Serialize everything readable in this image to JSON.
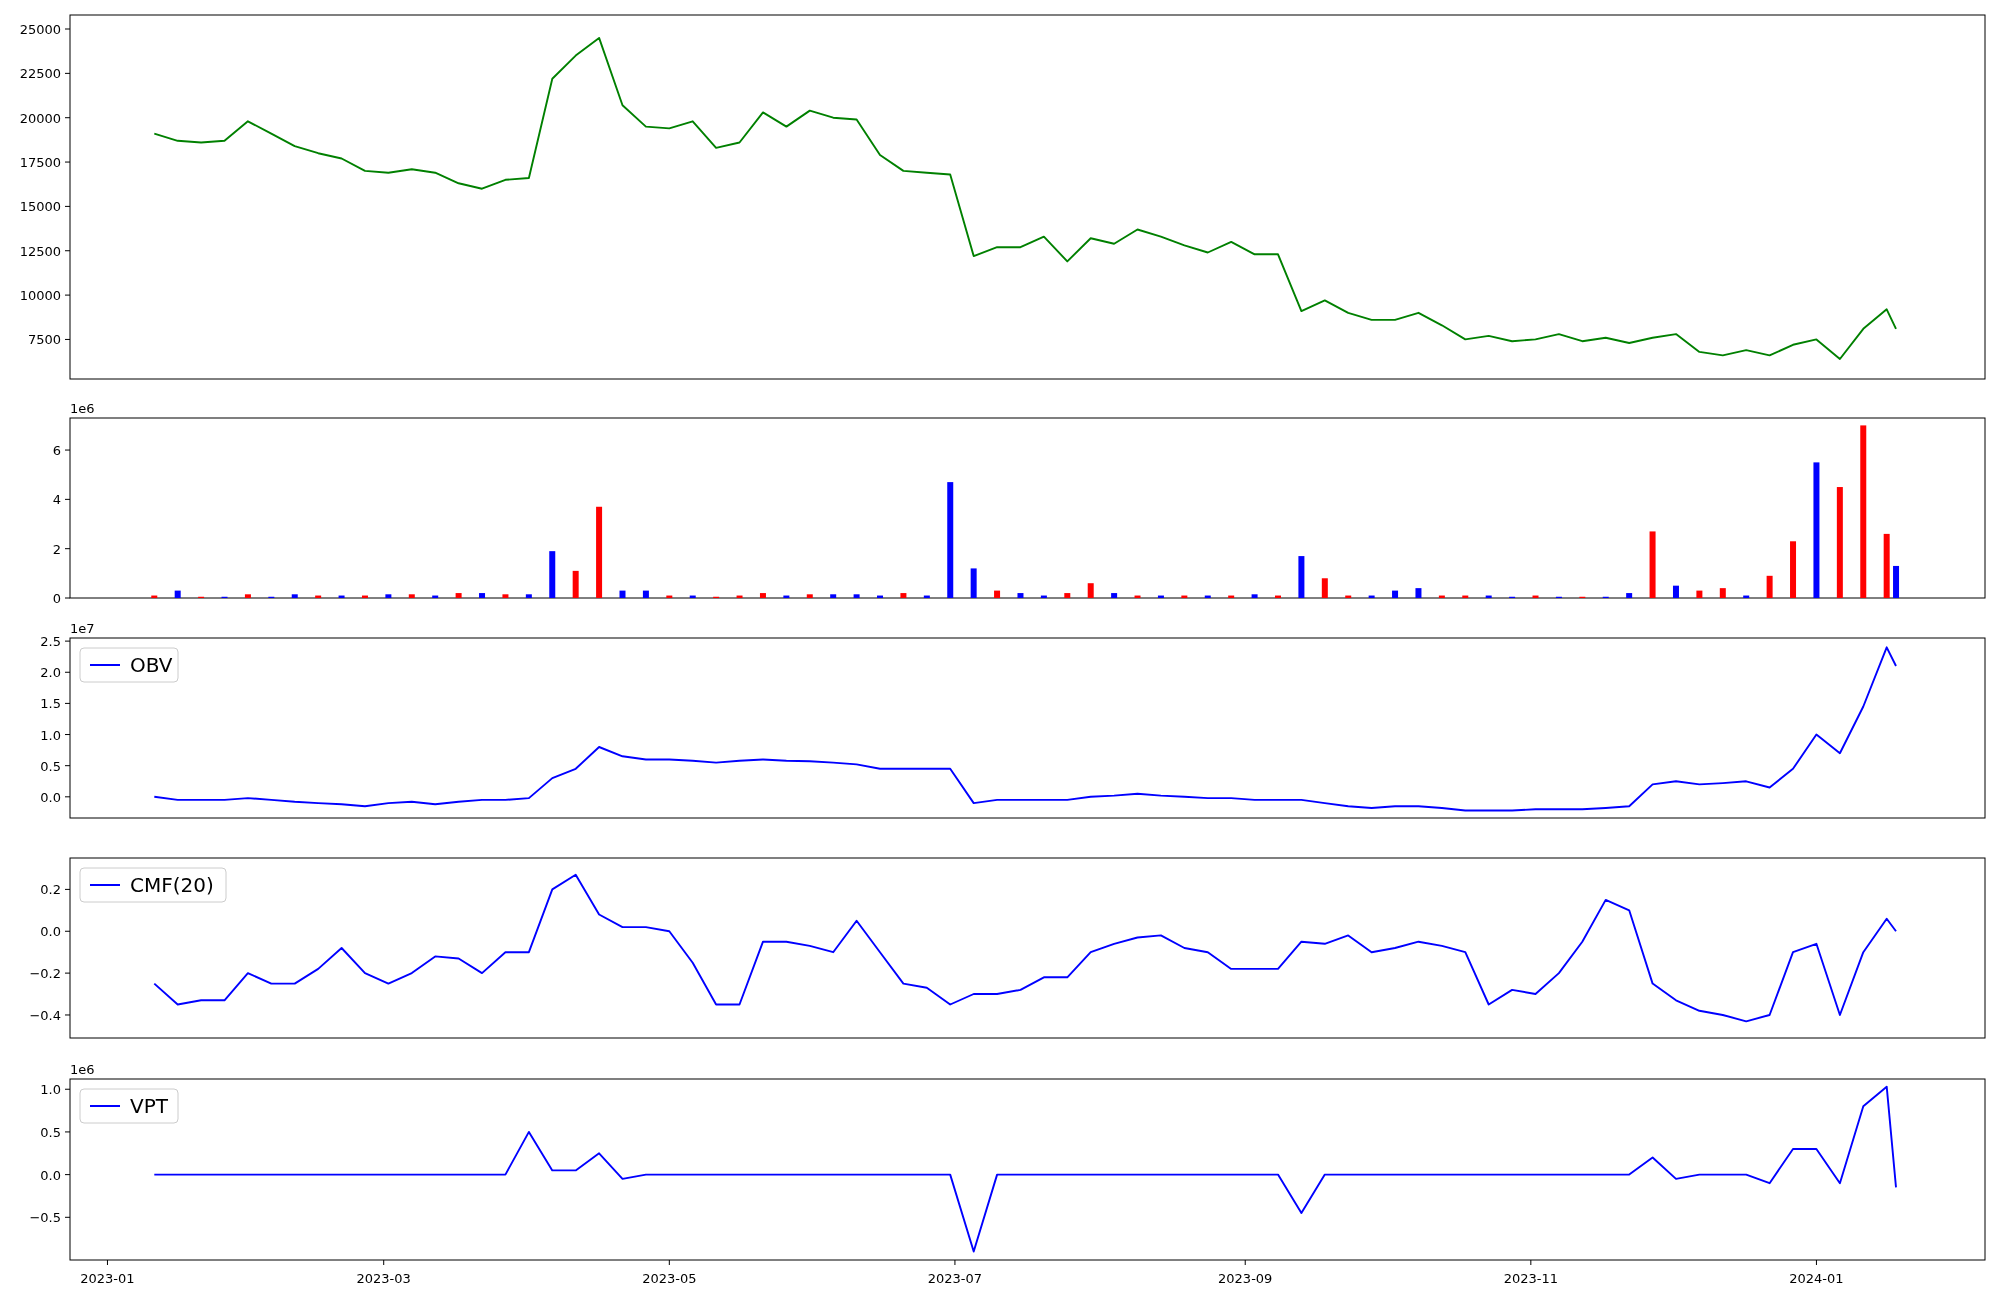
{
  "figure": {
    "panels": [
      {
        "chart_data": {
          "type": "line",
          "xlim": [
            "2022-12-24",
            "2024-02-06"
          ],
          "ylim": [
            5270,
            25790
          ],
          "yticks": [
            7500,
            10000,
            12500,
            15000,
            17500,
            20000,
            22500,
            25000
          ],
          "x": [
            "2023-01-11",
            "2023-01-16",
            "2023-01-21",
            "2023-01-26",
            "2023-01-31",
            "2023-02-05",
            "2023-02-10",
            "2023-02-15",
            "2023-02-20",
            "2023-02-25",
            "2023-03-02",
            "2023-03-07",
            "2023-03-12",
            "2023-03-17",
            "2023-03-22",
            "2023-03-27",
            "2023-04-01",
            "2023-04-06",
            "2023-04-11",
            "2023-04-16",
            "2023-04-21",
            "2023-04-26",
            "2023-05-01",
            "2023-05-06",
            "2023-05-11",
            "2023-05-16",
            "2023-05-21",
            "2023-05-26",
            "2023-05-31",
            "2023-06-05",
            "2023-06-10",
            "2023-06-15",
            "2023-06-20",
            "2023-06-25",
            "2023-06-30",
            "2023-07-05",
            "2023-07-10",
            "2023-07-15",
            "2023-07-20",
            "2023-07-25",
            "2023-07-30",
            "2023-08-04",
            "2023-08-09",
            "2023-08-14",
            "2023-08-19",
            "2023-08-24",
            "2023-08-29",
            "2023-09-03",
            "2023-09-08",
            "2023-09-13",
            "2023-09-18",
            "2023-09-23",
            "2023-09-28",
            "2023-10-03",
            "2023-10-08",
            "2023-10-13",
            "2023-10-18",
            "2023-10-23",
            "2023-10-28",
            "2023-11-02",
            "2023-11-07",
            "2023-11-12",
            "2023-11-17",
            "2023-11-22",
            "2023-11-27",
            "2023-12-02",
            "2023-12-07",
            "2023-12-12",
            "2023-12-17",
            "2023-12-22",
            "2023-12-27",
            "2024-01-01",
            "2024-01-06",
            "2024-01-11",
            "2024-01-16",
            "2024-01-18"
          ],
          "series": [
            {
              "color": "#008000",
              "values": [
                19100,
                18700,
                18600,
                18700,
                19800,
                19100,
                18400,
                18000,
                17700,
                17000,
                16900,
                17100,
                16900,
                16300,
                16000,
                16500,
                16600,
                22200,
                23500,
                24500,
                20700,
                19500,
                19400,
                19800,
                18300,
                18600,
                20300,
                19500,
                20400,
                20000,
                19900,
                17900,
                17000,
                16900,
                16800,
                12200,
                12700,
                12700,
                13300,
                11900,
                13200,
                12900,
                13700,
                13300,
                12800,
                12400,
                13000,
                12300,
                12300,
                9100,
                9700,
                9000,
                8600,
                8600,
                9000,
                8300,
                7500,
                7700,
                7400,
                7500,
                7800,
                7400,
                7600,
                7300,
                7600,
                7800,
                6800,
                6600,
                6900,
                6600,
                7200,
                7500,
                6400,
                8100,
                9200,
                8100
              ]
            }
          ]
        }
      },
      {
        "offset_text": "1e6",
        "chart_data": {
          "type": "bar",
          "xlim": [
            "2022-12-24",
            "2024-02-06"
          ],
          "ylim": [
            0,
            7.3
          ],
          "yticks": [
            0,
            2,
            4,
            6
          ],
          "x": [
            "2023-01-11",
            "2023-01-16",
            "2023-01-21",
            "2023-01-26",
            "2023-01-31",
            "2023-02-05",
            "2023-02-10",
            "2023-02-15",
            "2023-02-20",
            "2023-02-25",
            "2023-03-02",
            "2023-03-07",
            "2023-03-12",
            "2023-03-17",
            "2023-03-22",
            "2023-03-27",
            "2023-04-01",
            "2023-04-06",
            "2023-04-11",
            "2023-04-16",
            "2023-04-21",
            "2023-04-26",
            "2023-05-01",
            "2023-05-06",
            "2023-05-11",
            "2023-05-16",
            "2023-05-21",
            "2023-05-26",
            "2023-05-31",
            "2023-06-05",
            "2023-06-10",
            "2023-06-15",
            "2023-06-20",
            "2023-06-25",
            "2023-06-30",
            "2023-07-05",
            "2023-07-10",
            "2023-07-15",
            "2023-07-20",
            "2023-07-25",
            "2023-07-30",
            "2023-08-04",
            "2023-08-09",
            "2023-08-14",
            "2023-08-19",
            "2023-08-24",
            "2023-08-29",
            "2023-09-03",
            "2023-09-08",
            "2023-09-13",
            "2023-09-18",
            "2023-09-23",
            "2023-09-28",
            "2023-10-03",
            "2023-10-08",
            "2023-10-13",
            "2023-10-18",
            "2023-10-23",
            "2023-10-28",
            "2023-11-02",
            "2023-11-07",
            "2023-11-12",
            "2023-11-17",
            "2023-11-22",
            "2023-11-27",
            "2023-12-02",
            "2023-12-07",
            "2023-12-12",
            "2023-12-17",
            "2023-12-22",
            "2023-12-27",
            "2024-01-01",
            "2024-01-06",
            "2024-01-11",
            "2024-01-16",
            "2024-01-18"
          ],
          "series": [
            {
              "color": "#0000ff",
              "values": [
                null,
                0.3,
                null,
                0.05,
                null,
                0.05,
                0.15,
                null,
                0.1,
                null,
                0.15,
                null,
                0.1,
                null,
                0.2,
                null,
                0.15,
                1.9,
                null,
                null,
                0.3,
                0.3,
                null,
                0.1,
                null,
                null,
                null,
                0.1,
                null,
                0.15,
                0.15,
                0.1,
                null,
                0.1,
                4.7,
                1.2,
                null,
                0.2,
                0.1,
                null,
                null,
                0.2,
                null,
                0.1,
                null,
                0.1,
                null,
                0.15,
                null,
                1.7,
                null,
                null,
                0.1,
                0.3,
                0.4,
                null,
                null,
                0.1,
                0.05,
                null,
                0.05,
                null,
                0.05,
                0.2,
                null,
                0.5,
                null,
                null,
                0.1,
                null,
                null,
                5.5,
                null,
                null,
                null,
                1.3
              ]
            },
            {
              "color": "#ff0000",
              "values": [
                0.1,
                null,
                0.05,
                null,
                0.15,
                null,
                null,
                0.1,
                null,
                0.1,
                null,
                0.15,
                null,
                0.2,
                null,
                0.15,
                null,
                null,
                1.1,
                3.7,
                null,
                null,
                0.1,
                null,
                0.05,
                0.1,
                0.2,
                null,
                0.15,
                null,
                null,
                null,
                0.2,
                null,
                null,
                null,
                0.3,
                null,
                null,
                0.2,
                0.6,
                null,
                0.1,
                null,
                0.1,
                null,
                0.1,
                null,
                0.1,
                null,
                0.8,
                0.1,
                null,
                null,
                null,
                0.1,
                0.1,
                null,
                null,
                0.1,
                null,
                0.05,
                null,
                null,
                2.7,
                null,
                0.3,
                0.4,
                null,
                0.9,
                2.3,
                null,
                4.5,
                7.0,
                2.6,
                null
              ]
            }
          ]
        }
      },
      {
        "offset_text": "1e7",
        "chart_data": {
          "type": "line",
          "xlim": [
            "2022-12-24",
            "2024-02-06"
          ],
          "ylim": [
            -0.34,
            2.55
          ],
          "yticks": [
            {
              "value": 0,
              "label": "0.0"
            },
            {
              "value": 0.5,
              "label": "0.5"
            },
            {
              "value": 1,
              "label": "1.0"
            },
            {
              "value": 1.5,
              "label": "1.5"
            },
            {
              "value": 2,
              "label": "2.0"
            },
            {
              "value": 2.5,
              "label": "2.5"
            }
          ],
          "x": [
            "2023-01-11",
            "2023-01-16",
            "2023-01-21",
            "2023-01-26",
            "2023-01-31",
            "2023-02-05",
            "2023-02-10",
            "2023-02-15",
            "2023-02-20",
            "2023-02-25",
            "2023-03-02",
            "2023-03-07",
            "2023-03-12",
            "2023-03-17",
            "2023-03-22",
            "2023-03-27",
            "2023-04-01",
            "2023-04-06",
            "2023-04-11",
            "2023-04-16",
            "2023-04-21",
            "2023-04-26",
            "2023-05-01",
            "2023-05-06",
            "2023-05-11",
            "2023-05-16",
            "2023-05-21",
            "2023-05-26",
            "2023-05-31",
            "2023-06-05",
            "2023-06-10",
            "2023-06-15",
            "2023-06-20",
            "2023-06-25",
            "2023-06-30",
            "2023-07-05",
            "2023-07-10",
            "2023-07-15",
            "2023-07-20",
            "2023-07-25",
            "2023-07-30",
            "2023-08-04",
            "2023-08-09",
            "2023-08-14",
            "2023-08-19",
            "2023-08-24",
            "2023-08-29",
            "2023-09-03",
            "2023-09-08",
            "2023-09-13",
            "2023-09-18",
            "2023-09-23",
            "2023-09-28",
            "2023-10-03",
            "2023-10-08",
            "2023-10-13",
            "2023-10-18",
            "2023-10-23",
            "2023-10-28",
            "2023-11-02",
            "2023-11-07",
            "2023-11-12",
            "2023-11-17",
            "2023-11-22",
            "2023-11-27",
            "2023-12-02",
            "2023-12-07",
            "2023-12-12",
            "2023-12-17",
            "2023-12-22",
            "2023-12-27",
            "2024-01-01",
            "2024-01-06",
            "2024-01-11",
            "2024-01-16",
            "2024-01-18"
          ],
          "series": [
            {
              "name": "OBV",
              "color": "#0000ff",
              "values": [
                0,
                -0.05,
                -0.05,
                -0.05,
                -0.02,
                -0.05,
                -0.08,
                -0.1,
                -0.12,
                -0.15,
                -0.1,
                -0.08,
                -0.12,
                -0.08,
                -0.05,
                -0.05,
                -0.02,
                0.3,
                0.45,
                0.8,
                0.65,
                0.6,
                0.6,
                0.58,
                0.55,
                0.58,
                0.6,
                0.58,
                0.57,
                0.55,
                0.52,
                0.45,
                0.45,
                0.45,
                0.45,
                -0.1,
                -0.05,
                -0.05,
                -0.05,
                -0.05,
                0,
                0.02,
                0.05,
                0.02,
                0,
                -0.02,
                -0.02,
                -0.05,
                -0.05,
                -0.05,
                -0.1,
                -0.15,
                -0.18,
                -0.15,
                -0.15,
                -0.18,
                -0.22,
                -0.22,
                -0.22,
                -0.2,
                -0.2,
                -0.2,
                -0.18,
                -0.15,
                0.2,
                0.25,
                0.2,
                0.22,
                0.25,
                0.15,
                0.45,
                1.0,
                0.7,
                1.45,
                2.4,
                2.1
              ]
            }
          ]
        }
      },
      {
        "chart_data": {
          "type": "line",
          "xlim": [
            "2022-12-24",
            "2024-02-06"
          ],
          "ylim": [
            -0.51,
            0.35
          ],
          "yticks": [
            {
              "value": -0.4,
              "label": "−0.4"
            },
            {
              "value": -0.2,
              "label": "−0.2"
            },
            {
              "value": 0,
              "label": "0.0"
            },
            {
              "value": 0.2,
              "label": "0.2"
            }
          ],
          "x": [
            "2023-01-11",
            "2023-01-16",
            "2023-01-21",
            "2023-01-26",
            "2023-01-31",
            "2023-02-05",
            "2023-02-10",
            "2023-02-15",
            "2023-02-20",
            "2023-02-25",
            "2023-03-02",
            "2023-03-07",
            "2023-03-12",
            "2023-03-17",
            "2023-03-22",
            "2023-03-27",
            "2023-04-01",
            "2023-04-06",
            "2023-04-11",
            "2023-04-16",
            "2023-04-21",
            "2023-04-26",
            "2023-05-01",
            "2023-05-06",
            "2023-05-11",
            "2023-05-16",
            "2023-05-21",
            "2023-05-26",
            "2023-05-31",
            "2023-06-05",
            "2023-06-10",
            "2023-06-15",
            "2023-06-20",
            "2023-06-25",
            "2023-06-30",
            "2023-07-05",
            "2023-07-10",
            "2023-07-15",
            "2023-07-20",
            "2023-07-25",
            "2023-07-30",
            "2023-08-04",
            "2023-08-09",
            "2023-08-14",
            "2023-08-19",
            "2023-08-24",
            "2023-08-29",
            "2023-09-03",
            "2023-09-08",
            "2023-09-13",
            "2023-09-18",
            "2023-09-23",
            "2023-09-28",
            "2023-10-03",
            "2023-10-08",
            "2023-10-13",
            "2023-10-18",
            "2023-10-23",
            "2023-10-28",
            "2023-11-02",
            "2023-11-07",
            "2023-11-12",
            "2023-11-17",
            "2023-11-22",
            "2023-11-27",
            "2023-12-02",
            "2023-12-07",
            "2023-12-12",
            "2023-12-17",
            "2023-12-22",
            "2023-12-27",
            "2024-01-01",
            "2024-01-06",
            "2024-01-11",
            "2024-01-16",
            "2024-01-18"
          ],
          "series": [
            {
              "name": "CMF(20)",
              "color": "#0000ff",
              "values": [
                -0.25,
                -0.35,
                -0.33,
                -0.33,
                -0.2,
                -0.25,
                -0.25,
                -0.18,
                -0.08,
                -0.2,
                -0.25,
                -0.2,
                -0.12,
                -0.13,
                -0.2,
                -0.1,
                -0.1,
                0.2,
                0.27,
                0.08,
                0.02,
                0.02,
                0,
                -0.15,
                -0.35,
                -0.35,
                -0.05,
                -0.05,
                -0.07,
                -0.1,
                0.05,
                -0.1,
                -0.25,
                -0.27,
                -0.35,
                -0.3,
                -0.3,
                -0.28,
                -0.22,
                -0.22,
                -0.1,
                -0.06,
                -0.03,
                -0.02,
                -0.08,
                -0.1,
                -0.18,
                -0.18,
                -0.18,
                -0.05,
                -0.06,
                -0.02,
                -0.1,
                -0.08,
                -0.05,
                -0.07,
                -0.1,
                -0.35,
                -0.28,
                -0.3,
                -0.2,
                -0.05,
                0.15,
                0.1,
                -0.25,
                -0.33,
                -0.38,
                -0.4,
                -0.43,
                -0.4,
                -0.1,
                -0.06,
                -0.4,
                -0.1,
                0.06,
                0
              ]
            }
          ]
        }
      },
      {
        "offset_text": "1e6",
        "chart_data": {
          "type": "line",
          "xlim": [
            "2022-12-24",
            "2024-02-06"
          ],
          "ylim": [
            -1.0,
            1.12
          ],
          "yticks": [
            {
              "value": -0.5,
              "label": "−0.5"
            },
            {
              "value": 0,
              "label": "0.0"
            },
            {
              "value": 0.5,
              "label": "0.5"
            },
            {
              "value": 1,
              "label": "1.0"
            }
          ],
          "xticks": [
            {
              "value": "2023-01-01",
              "label": "2023-01"
            },
            {
              "value": "2023-03-01",
              "label": "2023-03"
            },
            {
              "value": "2023-05-01",
              "label": "2023-05"
            },
            {
              "value": "2023-07-01",
              "label": "2023-07"
            },
            {
              "value": "2023-09-01",
              "label": "2023-09"
            },
            {
              "value": "2023-11-01",
              "label": "2023-11"
            },
            {
              "value": "2024-01-01",
              "label": "2024-01"
            }
          ],
          "x": [
            "2023-01-11",
            "2023-01-16",
            "2023-01-21",
            "2023-01-26",
            "2023-01-31",
            "2023-02-05",
            "2023-02-10",
            "2023-02-15",
            "2023-02-20",
            "2023-02-25",
            "2023-03-02",
            "2023-03-07",
            "2023-03-12",
            "2023-03-17",
            "2023-03-22",
            "2023-03-27",
            "2023-04-01",
            "2023-04-06",
            "2023-04-11",
            "2023-04-16",
            "2023-04-21",
            "2023-04-26",
            "2023-05-01",
            "2023-05-06",
            "2023-05-11",
            "2023-05-16",
            "2023-05-21",
            "2023-05-26",
            "2023-05-31",
            "2023-06-05",
            "2023-06-10",
            "2023-06-15",
            "2023-06-20",
            "2023-06-25",
            "2023-06-30",
            "2023-07-05",
            "2023-07-10",
            "2023-07-15",
            "2023-07-20",
            "2023-07-25",
            "2023-07-30",
            "2023-08-04",
            "2023-08-09",
            "2023-08-14",
            "2023-08-19",
            "2023-08-24",
            "2023-08-29",
            "2023-09-03",
            "2023-09-08",
            "2023-09-13",
            "2023-09-18",
            "2023-09-23",
            "2023-09-28",
            "2023-10-03",
            "2023-10-08",
            "2023-10-13",
            "2023-10-18",
            "2023-10-23",
            "2023-10-28",
            "2023-11-02",
            "2023-11-07",
            "2023-11-12",
            "2023-11-17",
            "2023-11-22",
            "2023-11-27",
            "2023-12-02",
            "2023-12-07",
            "2023-12-12",
            "2023-12-17",
            "2023-12-22",
            "2023-12-27",
            "2024-01-01",
            "2024-01-06",
            "2024-01-11",
            "2024-01-16",
            "2024-01-18"
          ],
          "series": [
            {
              "name": "VPT",
              "color": "#0000ff",
              "values": [
                0,
                0,
                0,
                0,
                0,
                0,
                0,
                0,
                0,
                0,
                0,
                0,
                0,
                0,
                0,
                0,
                0.5,
                0.05,
                0.05,
                0.25,
                -0.05,
                0,
                0,
                0,
                0,
                0,
                0,
                0,
                0,
                0,
                0,
                0,
                0,
                0,
                0,
                -0.9,
                0,
                0,
                0,
                0,
                0,
                0,
                0,
                0,
                0,
                0,
                0,
                0,
                0,
                -0.45,
                0,
                0,
                0,
                0,
                0,
                0,
                0,
                0,
                0,
                0,
                0,
                0,
                0,
                0,
                0.2,
                -0.05,
                0,
                0,
                0,
                -0.1,
                0.3,
                0.3,
                -0.1,
                0.8,
                1.03,
                -0.15
              ]
            }
          ]
        }
      }
    ]
  }
}
